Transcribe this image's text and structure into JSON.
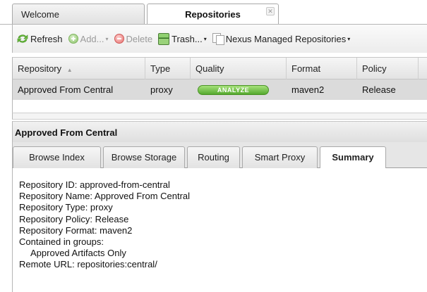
{
  "top_tabs": [
    {
      "label": "Welcome"
    },
    {
      "label": "Repositories",
      "close_glyph": "✕"
    }
  ],
  "toolbar": {
    "refresh_label": "Refresh",
    "add_label": "Add...",
    "delete_label": "Delete",
    "trash_label": "Trash...",
    "view_label": "Nexus Managed Repositories",
    "caret": "▾"
  },
  "grid": {
    "columns": [
      "Repository",
      "Type",
      "Quality",
      "Format",
      "Policy"
    ],
    "sort_indicator": "▲",
    "rows": [
      {
        "repository": "Approved From Central",
        "type": "proxy",
        "quality": "ANALYZE",
        "format": "maven2",
        "policy": "Release"
      }
    ]
  },
  "detail": {
    "title": "Approved From Central",
    "tabs": [
      "Browse Index",
      "Browse Storage",
      "Routing",
      "Smart Proxy",
      "Summary"
    ],
    "active_tab": "Summary",
    "summary_lines": [
      "Repository ID: approved-from-central",
      "Repository Name: Approved From Central",
      "Repository Type: proxy",
      "Repository Policy: Release",
      "Repository Format: maven2",
      "Contained in groups:",
      "Approved Artifacts Only",
      "Remote URL: repositories:central/"
    ]
  },
  "colors": {
    "accent_green": "#55a92f",
    "selected_row": "#dbdbdb",
    "delete_red": "#e6706e"
  },
  "icons": [
    "refresh-icon",
    "add-icon",
    "delete-icon",
    "trash-icon",
    "repositories-view-icon",
    "close-icon"
  ]
}
